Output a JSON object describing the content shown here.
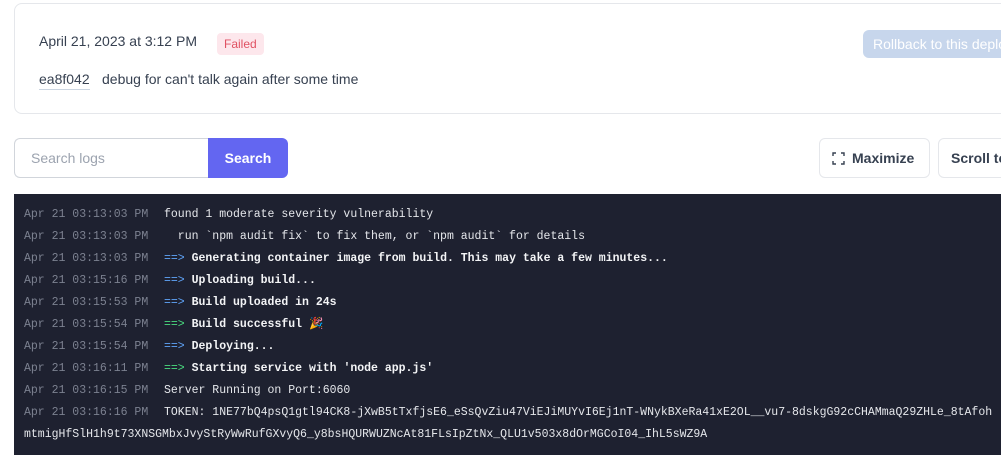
{
  "deploy": {
    "date": "April 21, 2023 at 3:12 PM",
    "status": "Failed",
    "commit_hash": "ea8f042",
    "commit_message": "debug for can't talk again after some time",
    "rollback_label": "Rollback to this deploy"
  },
  "toolbar": {
    "search_placeholder": "Search logs",
    "search_label": "Search",
    "maximize_label": "Maximize",
    "scroll_label": "Scroll to bottom"
  },
  "colors": {
    "accent": "#6366f1",
    "failed": "#e05263",
    "log_bg": "#1e2130",
    "arrow_blue": "#60a5fa",
    "arrow_green": "#4ade80"
  },
  "logs": [
    {
      "time": "Apr 21 03:13:03 PM",
      "arrow": "",
      "text": "found 1 moderate severity vulnerability"
    },
    {
      "time": "Apr 21 03:13:03 PM",
      "arrow": "",
      "text": "  run `npm audit fix` to fix them, or `npm audit` for details"
    },
    {
      "time": "Apr 21 03:13:03 PM",
      "arrow": "blue",
      "text": "Generating container image from build. This may take a few minutes..."
    },
    {
      "time": "Apr 21 03:15:16 PM",
      "arrow": "blue",
      "text": "Uploading build..."
    },
    {
      "time": "Apr 21 03:15:53 PM",
      "arrow": "blue",
      "text": "Build uploaded in 24s"
    },
    {
      "time": "Apr 21 03:15:54 PM",
      "arrow": "green",
      "text": "Build successful 🎉"
    },
    {
      "time": "Apr 21 03:15:54 PM",
      "arrow": "blue",
      "text": "Deploying..."
    },
    {
      "time": "Apr 21 03:16:11 PM",
      "arrow": "green",
      "text": "Starting service with 'node app.js'"
    },
    {
      "time": "Apr 21 03:16:15 PM",
      "arrow": "",
      "text": "Server Running on Port:6060"
    },
    {
      "time": "Apr 21 03:16:16 PM",
      "arrow": "",
      "text": "TOKEN: 1NE77bQ4psQ1gtl94CK8-jXwB5tTxfjsE6_eSsQvZiu47ViEJiMUYvI6Ej1nT-WNykBXeRa41xE2OL__vu7-8dskgG92cCHAMmaQ29ZHLe_8tAfoh"
    }
  ],
  "log_wrap": "mtmigHfSlH1h9t73XNSGMbxJvyStRyWwRufGXvyQ6_y8bsHQURWUZNcAt81FLsIpZtNx_QLU1v503x8dOrMGCoI04_IhL5sWZ9A",
  "arrow_glyph": "==>"
}
